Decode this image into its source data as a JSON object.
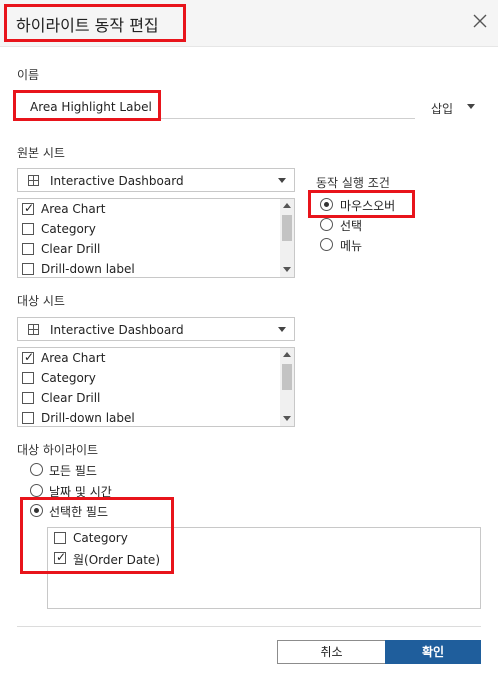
{
  "dialog": {
    "title": "하이라이트 동작 편집",
    "close_icon": "close-icon"
  },
  "name_section": {
    "label": "이름",
    "value": "Area Highlight Label",
    "insert_label": "삽입"
  },
  "source_sheets": {
    "label": "원본 시트",
    "dropdown_value": "Interactive Dashboard",
    "items": [
      {
        "label": "Area Chart",
        "checked": true
      },
      {
        "label": "Category",
        "checked": false
      },
      {
        "label": "Clear Drill",
        "checked": false
      },
      {
        "label": "Drill-down label",
        "checked": false
      }
    ]
  },
  "run_action_on": {
    "label": "동작 실행 조건",
    "options": [
      {
        "label": "마우스오버",
        "selected": true
      },
      {
        "label": "선택",
        "selected": false
      },
      {
        "label": "메뉴",
        "selected": false
      }
    ]
  },
  "target_sheets": {
    "label": "대상 시트",
    "dropdown_value": "Interactive Dashboard",
    "items": [
      {
        "label": "Area Chart",
        "checked": true
      },
      {
        "label": "Category",
        "checked": false
      },
      {
        "label": "Clear Drill",
        "checked": false
      },
      {
        "label": "Drill-down label",
        "checked": false
      }
    ]
  },
  "target_highlight": {
    "label": "대상 하이라이트",
    "options": [
      {
        "label": "모든 필드",
        "selected": false
      },
      {
        "label": "날짜 및 시간",
        "selected": false
      },
      {
        "label": "선택한 필드",
        "selected": true
      }
    ],
    "fields": [
      {
        "label": "Category",
        "checked": false
      },
      {
        "label": "월(Order Date)",
        "checked": true
      }
    ]
  },
  "buttons": {
    "cancel": "취소",
    "ok": "확인"
  },
  "colors": {
    "highlight_box": "#e8141b",
    "primary_button": "#1f5e9c"
  }
}
